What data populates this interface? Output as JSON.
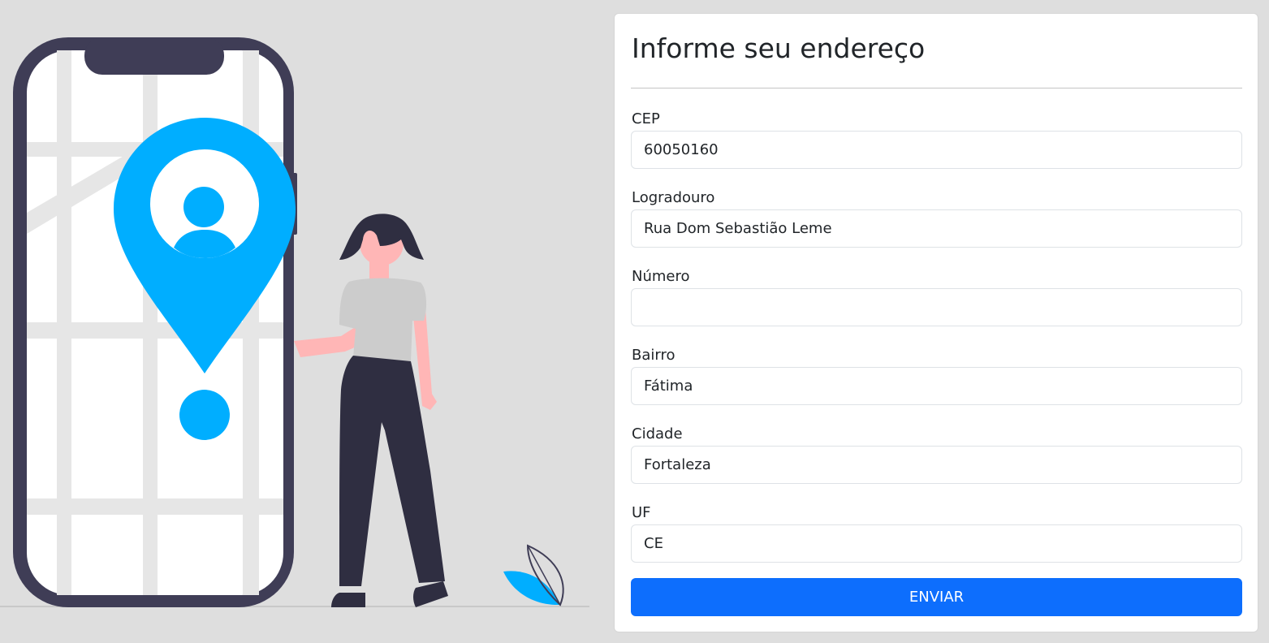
{
  "form": {
    "title": "Informe seu endereço",
    "fields": [
      {
        "label": "CEP",
        "value": "60050160",
        "placeholder": ""
      },
      {
        "label": "Logradouro",
        "value": "Rua Dom Sebastião Leme",
        "placeholder": ""
      },
      {
        "label": "Número",
        "value": "",
        "placeholder": ""
      },
      {
        "label": "Bairro",
        "value": "Fátima",
        "placeholder": ""
      },
      {
        "label": "Cidade",
        "value": "Fortaleza",
        "placeholder": ""
      },
      {
        "label": "UF",
        "value": "CE",
        "placeholder": ""
      }
    ],
    "submit_label": "ENVIAR"
  },
  "illustration": {
    "icons": [
      "smartphone-map",
      "location-pin-icon",
      "user-icon",
      "person-figure",
      "plant-leaf-icon"
    ],
    "colors": {
      "accent": "#00aeff",
      "phone_frame": "#3f3d56",
      "map_roads": "#e6e6e6",
      "skin": "#ffb6b6",
      "shirt": "#cccccc",
      "pants": "#2f2e41",
      "button": "#0d6efd"
    }
  }
}
